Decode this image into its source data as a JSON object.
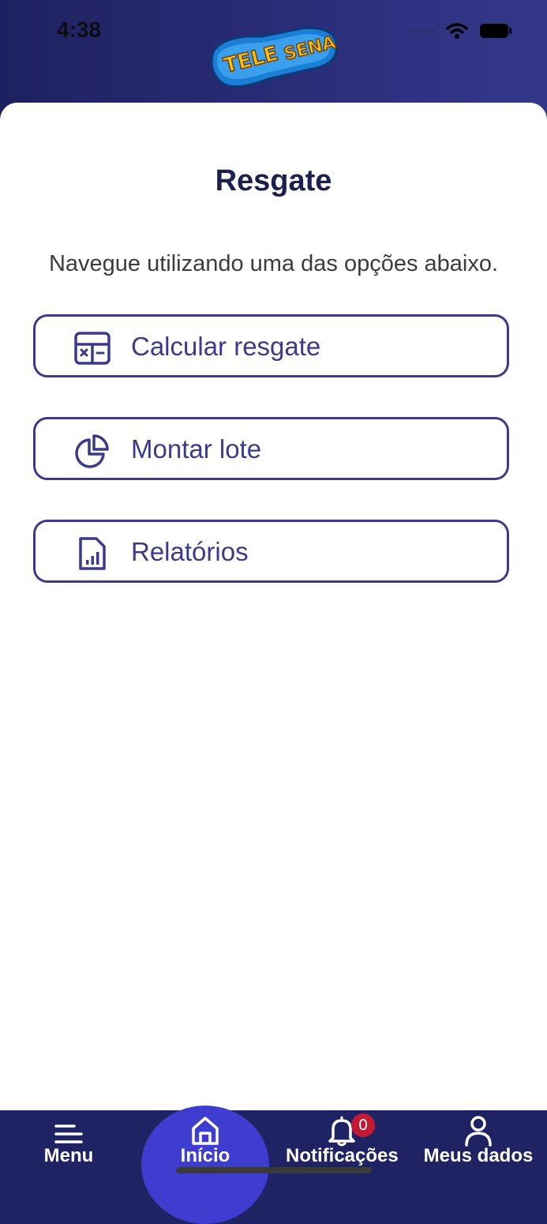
{
  "status_bar": {
    "time": "4:38"
  },
  "brand": {
    "logo_text": "TELE SENA"
  },
  "page": {
    "title": "Resgate",
    "subtitle": "Navegue utilizando uma das opções abaixo."
  },
  "options": [
    {
      "label": "Calcular resgate",
      "icon": "calculator-icon"
    },
    {
      "label": "Montar lote",
      "icon": "pie-chart-icon"
    },
    {
      "label": "Relatórios",
      "icon": "report-document-icon"
    }
  ],
  "tabbar": {
    "menu": "Menu",
    "home": "Início",
    "notifications": "Notificações",
    "notifications_badge": "0",
    "profile": "Meus dados",
    "active": "home"
  },
  "colors": {
    "header": "#1e2160",
    "accent": "#3c3a8c",
    "tabbar": "#1f2363",
    "active_tab": "#3f3dcf",
    "badge": "#c21a34"
  }
}
